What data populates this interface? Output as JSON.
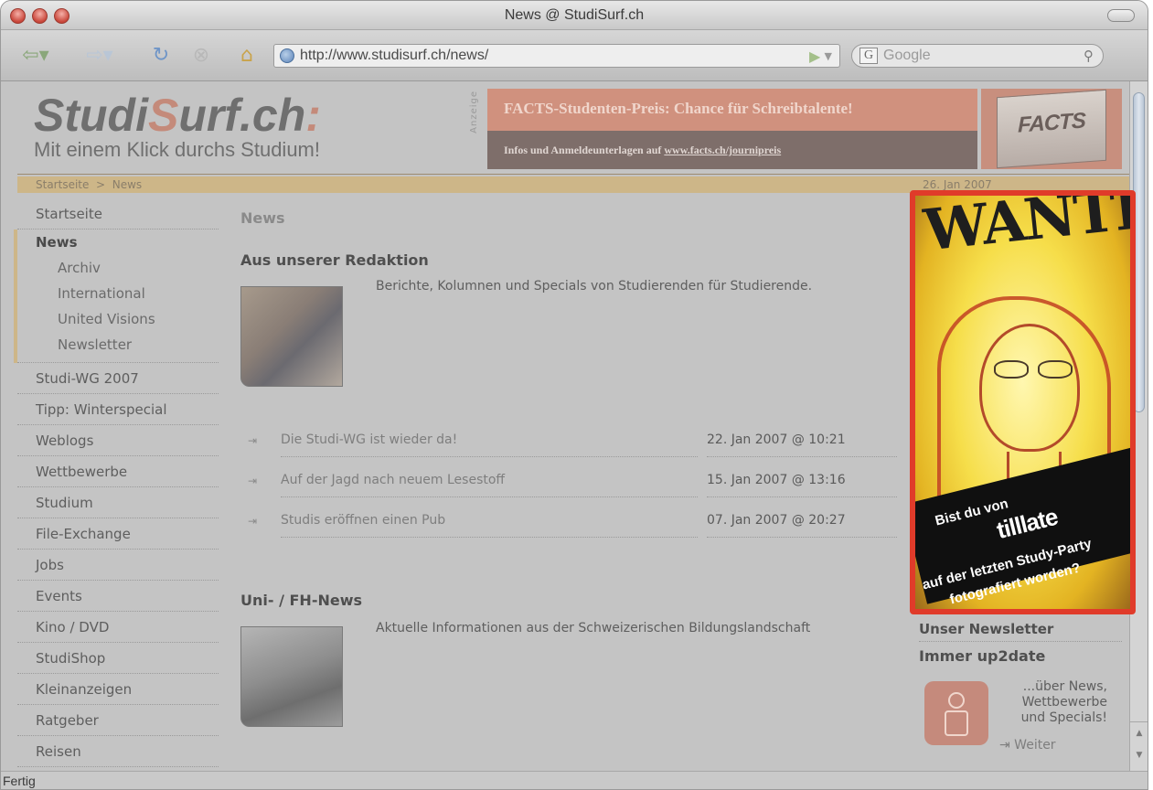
{
  "window": {
    "title": "News @ StudiSurf.ch",
    "status": "Fertig"
  },
  "toolbar": {
    "url": "http://www.studisurf.ch/news/",
    "search_engine_letter": "G",
    "search_placeholder": "Google",
    "icons": [
      "back-arrow-icon",
      "forward-arrow-icon",
      "reload-icon",
      "stop-icon",
      "home-icon",
      "globe-icon",
      "go-icon",
      "magnifier-icon"
    ]
  },
  "site": {
    "logo_prefix": "Studi",
    "logo_accent": "S",
    "logo_rest": "urf.ch",
    "logo_suffix": ":",
    "tagline": "Mit einem Klick durchs Studium!",
    "ad_label": "Anzeige",
    "ad_headline": "FACTS-Studenten-Preis: Chance für Schreibtalente!",
    "ad_sub_prefix": "Infos und Anmeldeunterlagen auf ",
    "ad_sub_link": "www.facts.ch/journipreis",
    "ad_magazine": "FACTS",
    "accent_color": "#e03b2a"
  },
  "breadcrumb": {
    "home": "Startseite",
    "separator": ">",
    "current": "News",
    "date": "26. Jan 2007"
  },
  "nav": {
    "top": "Startseite",
    "active": "News",
    "sub": [
      "Archiv",
      "International",
      "United Visions",
      "Newsletter"
    ],
    "items": [
      "Studi-WG 2007",
      "Tipp: Winterspecial",
      "Weblogs",
      "Wettbewerbe",
      "Studium",
      "File-Exchange",
      "Jobs",
      "Events",
      "Kino / DVD",
      "StudiShop",
      "Kleinanzeigen",
      "Ratgeber",
      "Reisen"
    ]
  },
  "main": {
    "heading": "News",
    "redaktion_title": "Aus unserer Redaktion",
    "redaktion_desc": "Berichte, Kolumnen und Specials von Studierenden für Studierende.",
    "articles": [
      {
        "title": "Die Studi-WG ist wieder da!",
        "date": "22. Jan 2007 @ 10:21"
      },
      {
        "title": "Auf der Jagd nach neuem Lesestoff",
        "date": "15. Jan 2007 @ 13:16"
      },
      {
        "title": "Studis eröffnen einen Pub",
        "date": "07. Jan 2007 @ 20:27"
      }
    ],
    "unifh_title": "Uni- / FH-News",
    "unifh_desc": "Aktuelle Informationen aus der Schweizerischen Bildungslandschaft",
    "article_arrow": "⇥"
  },
  "poster": {
    "wanted": "WANTED",
    "line1": "Bist du von",
    "line2": "tilllate",
    "line3": "auf der letzten Study-Party",
    "line4": "fotografiert worden?"
  },
  "newsletter": {
    "title": "Unser Newsletter",
    "subtitle": "Immer up2date",
    "text": "...über News, Wettbewerbe und Specials!",
    "link": "⇥ Weiter"
  }
}
